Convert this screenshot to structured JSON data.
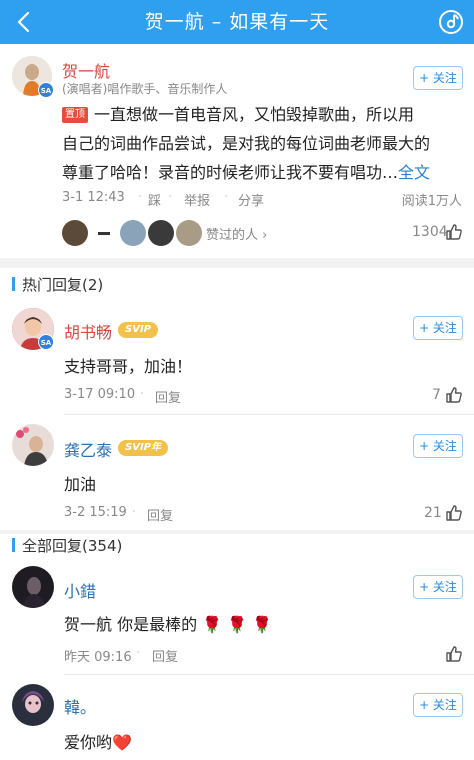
{
  "header": {
    "title": "贺一航 – 如果有一天",
    "bg": "#2f9ff0"
  },
  "post": {
    "author": "贺一航",
    "subtitle": "(演唱者)唱作歌手、音乐制作人",
    "follow": "+ 关注",
    "pin": "置顶",
    "lines": [
      "一直想做一首电音风，又怕毁掉歌曲，所以用",
      "自己的词曲作品尝试，是对我的每位词曲老师最大的",
      "尊重了哈哈！录音的时候老师让我不要有唱功…"
    ],
    "more": "全文",
    "time": "3-1 12:43",
    "dislike": "踩",
    "report": "举报",
    "share": "分享",
    "reads": "阅读1万人",
    "liked_by": "赞过的人",
    "like_count": "1304"
  },
  "hot": {
    "title": "热门回复(2)",
    "items": [
      {
        "name": "胡书畅",
        "vip": "SVIP",
        "text": "支持哥哥，加油！",
        "time": "3-17 09:10",
        "reply": "回复",
        "likes": "7",
        "follow": "+ 关注"
      },
      {
        "name": "龚乙泰",
        "vip": "SVIP年",
        "text": "加油",
        "time": "3-2 15:19",
        "reply": "回复",
        "likes": "21",
        "follow": "+ 关注"
      }
    ]
  },
  "all": {
    "title": "全部回复(354)",
    "items": [
      {
        "name": "小錯",
        "text": "贺一航 你是最棒的 🌹 🌹 🌹",
        "time": "昨天 09:16",
        "reply": "回复",
        "follow": "+ 关注"
      },
      {
        "name": "韓。",
        "text": "爱你哟❤️",
        "follow": "+ 关注"
      }
    ]
  }
}
